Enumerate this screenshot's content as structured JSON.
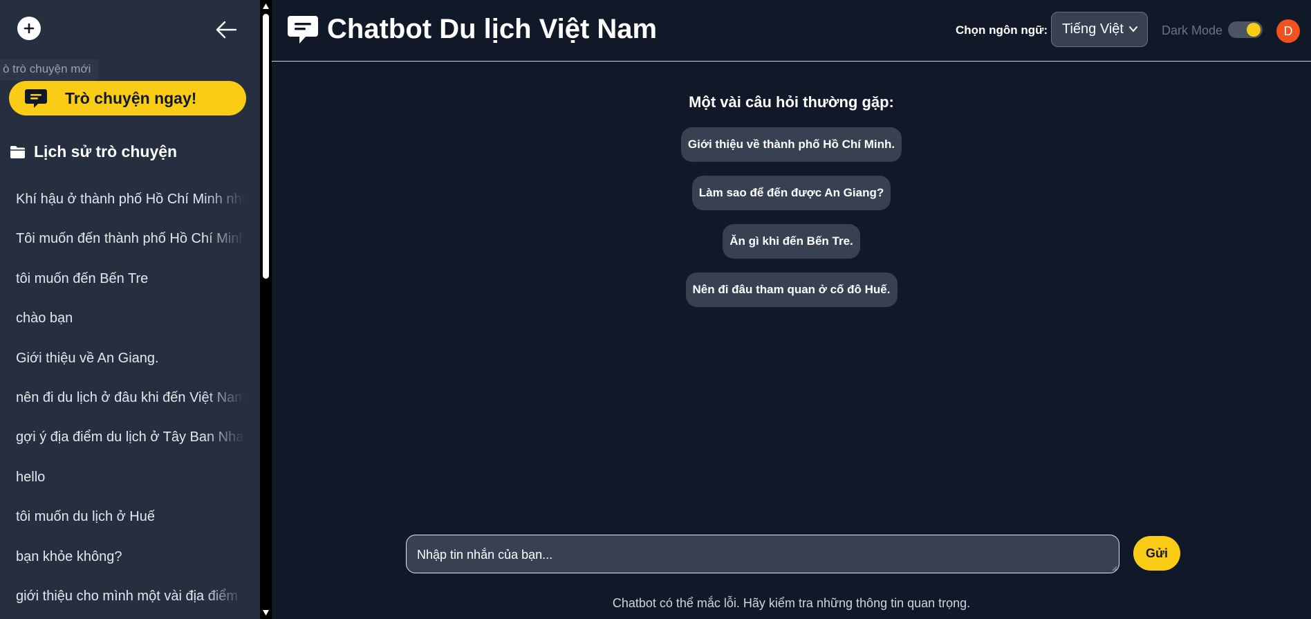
{
  "sidebar": {
    "new_chat_tooltip": "ò trò chuyện mới",
    "cta_label": "Trò chuyện ngay!",
    "history_title": "Lịch sử trò chuyện",
    "history": [
      "Khí hậu ở thành phố Hồ Chí Minh như thế nào?",
      "Tôi muốn đến thành phố Hồ Chí Minh",
      "tôi muốn đến Bến Tre",
      "chào bạn",
      "Giới thiệu về An Giang.",
      "nên đi du lịch ở đâu khi đến Việt Nam",
      "gợi ý địa điểm du lịch ở Tây Ban Nha.",
      "hello",
      "tôi muốn du lịch ở Huế",
      "bạn khỏe không?",
      "giới thiệu cho mình một vài địa điểm"
    ]
  },
  "header": {
    "title": "Chatbot Du lịch Việt Nam",
    "language_label": "Chọn ngôn ngữ:",
    "language_selected": "Tiếng Việt",
    "dark_mode_label": "Dark Mode",
    "avatar_initial": "D"
  },
  "faq": {
    "title": "Một vài câu hỏi thường gặp:",
    "questions": [
      "Giới thiệu về thành phố Hồ Chí Minh.",
      "Làm sao để đến được An Giang?",
      "Ăn gì khi đến Bến Tre.",
      "Nên đi đâu tham quan ở cố đô Huế."
    ]
  },
  "composer": {
    "placeholder": "Nhập tin nhắn của bạn...",
    "send_label": "Gửi"
  },
  "disclaimer": "Chatbot có thể mắc lỗi. Hãy kiểm tra những thông tin quan trọng.",
  "colors": {
    "background": "#111827",
    "sidebar": "#252f3f",
    "accent": "#facc15",
    "chip": "#374151",
    "avatar": "#f0511f"
  },
  "icons": {
    "new_chat": "plus-icon",
    "collapse": "arrow-left-icon",
    "cta": "chat-bubble-icon",
    "history": "folder-icon",
    "logo": "chat-bubble-icon",
    "language": "chevron-down-icon"
  }
}
